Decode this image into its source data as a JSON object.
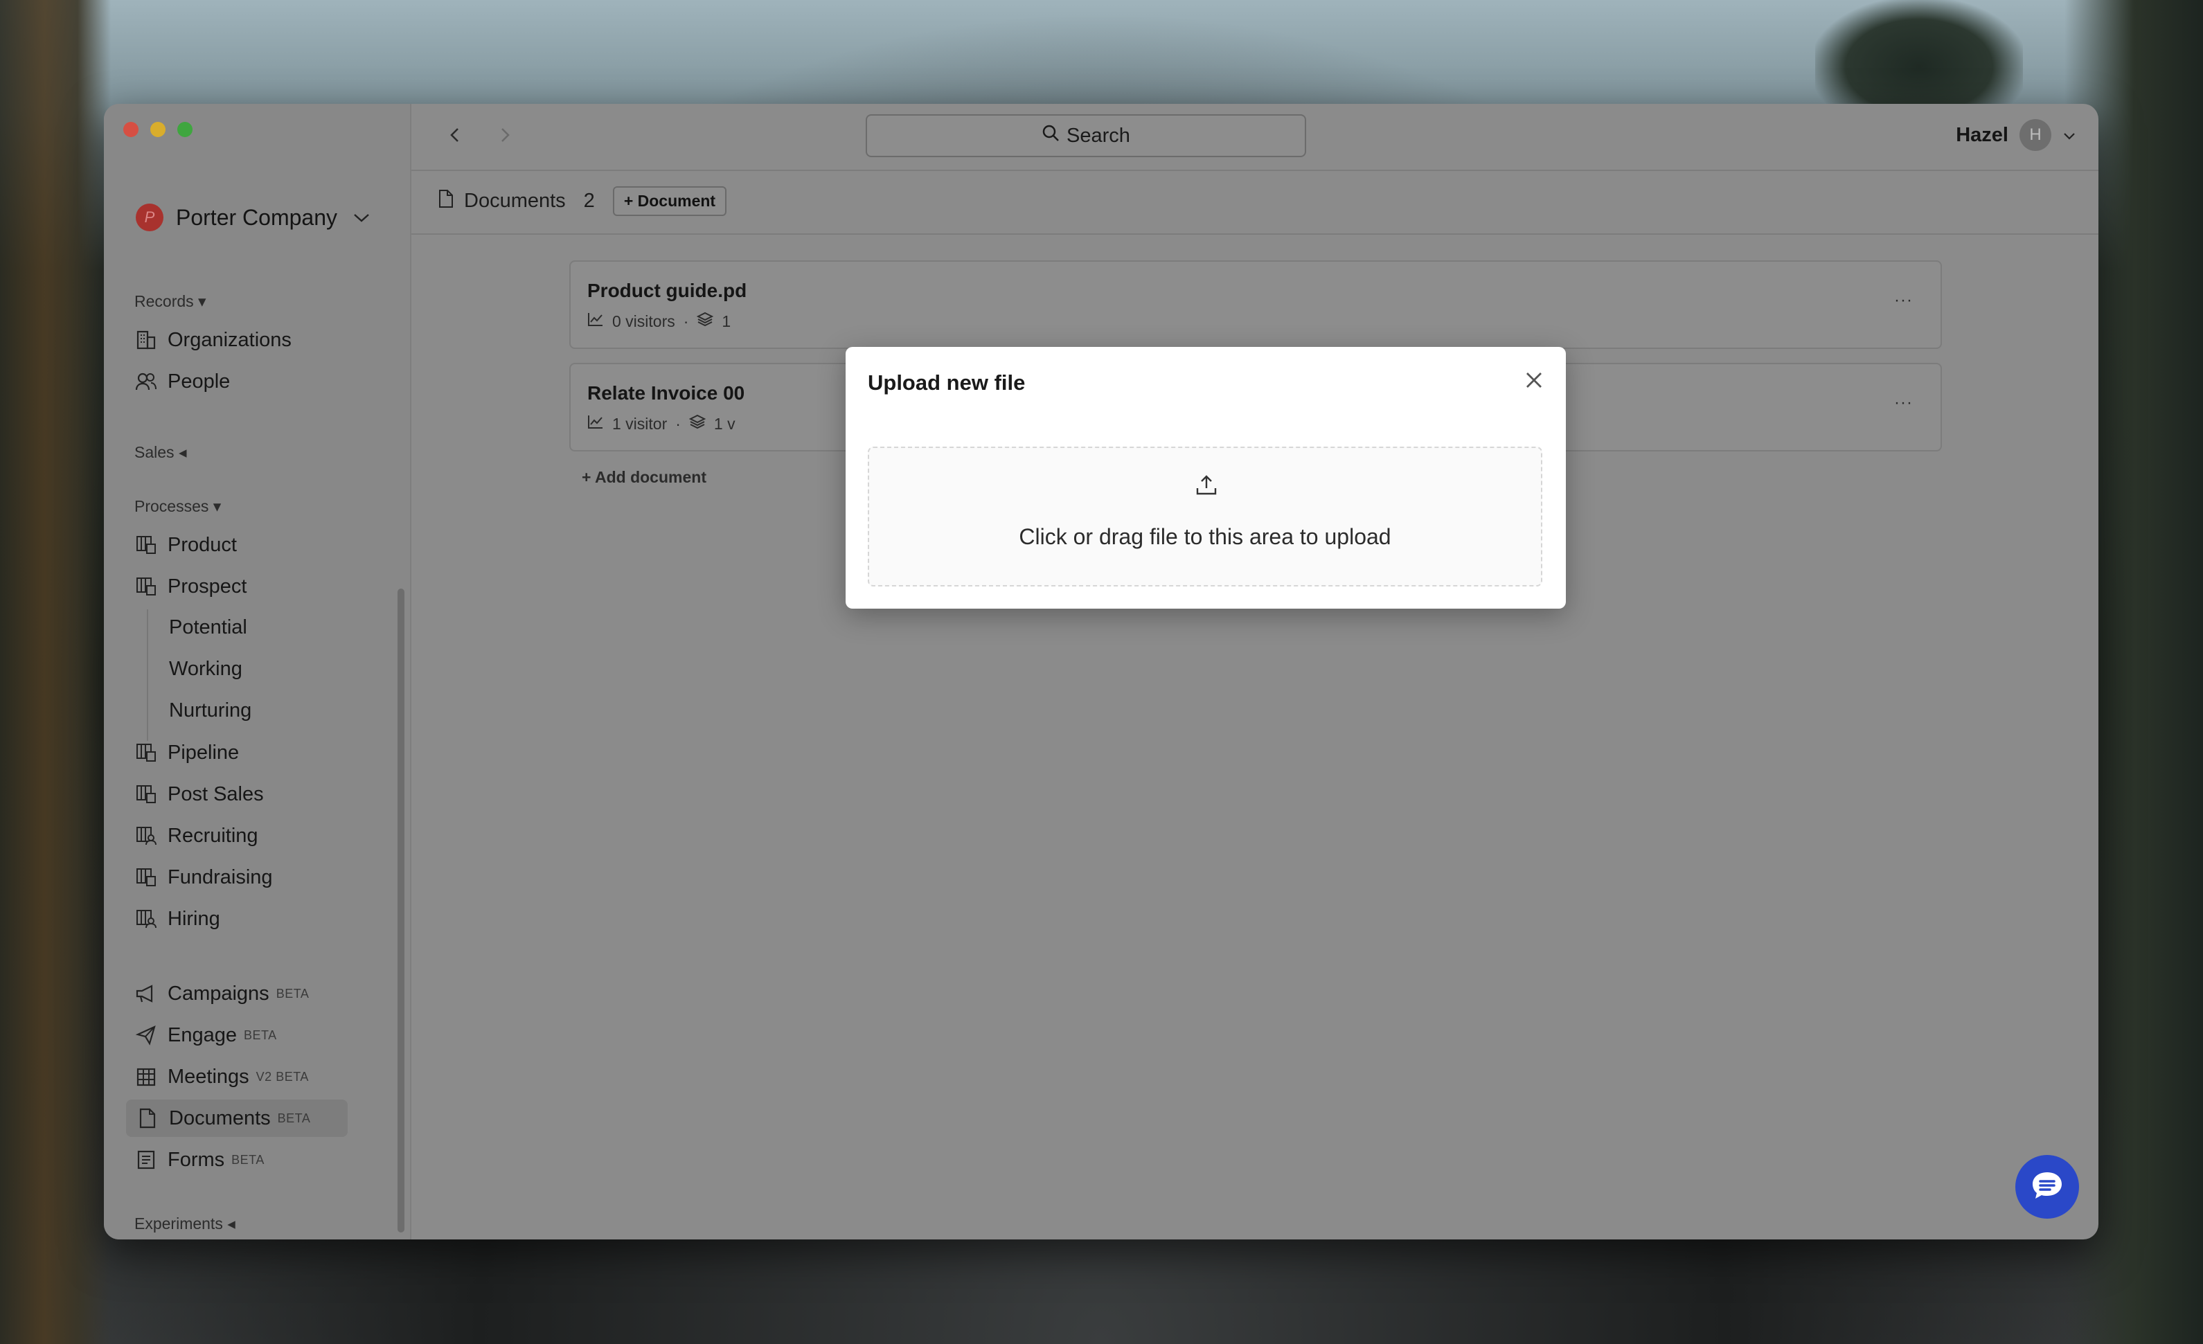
{
  "sidebar": {
    "company": {
      "logo_letter": "P",
      "name": "Porter Company"
    },
    "records": {
      "label": "Records",
      "items": [
        {
          "label": "Organizations",
          "icon": "building-icon"
        },
        {
          "label": "People",
          "icon": "people-icon"
        }
      ]
    },
    "sales": {
      "label": "Sales"
    },
    "processes": {
      "label": "Processes",
      "items": [
        {
          "label": "Product"
        },
        {
          "label": "Prospect"
        },
        {
          "label": "Potential"
        },
        {
          "label": "Working"
        },
        {
          "label": "Nurturing"
        },
        {
          "label": "Pipeline"
        },
        {
          "label": "Post Sales"
        },
        {
          "label": "Recruiting"
        },
        {
          "label": "Fundraising"
        },
        {
          "label": "Hiring"
        }
      ]
    },
    "apps": [
      {
        "label": "Campaigns",
        "badge": "BETA"
      },
      {
        "label": "Engage",
        "badge": "BETA"
      },
      {
        "label": "Meetings",
        "badge": "V2 BETA"
      },
      {
        "label": "Documents",
        "badge": "BETA"
      },
      {
        "label": "Forms",
        "badge": "BETA"
      }
    ],
    "experiments": {
      "label": "Experiments"
    }
  },
  "topbar": {
    "search_label": "Search",
    "user_name": "Hazel",
    "user_initial": "H"
  },
  "subbar": {
    "title": "Documents",
    "count": "2",
    "add_button": "Document"
  },
  "documents": [
    {
      "title": "Product guide.pd",
      "visitors": "0 visitors",
      "versions": "1"
    },
    {
      "title": "Relate Invoice 00",
      "visitors": "1 visitor",
      "versions": "1 v"
    }
  ],
  "add_document_label": "Add document",
  "modal": {
    "title": "Upload new file",
    "dropzone_text": "Click or drag file to this area to upload"
  },
  "colors": {
    "accent": "#2a48c8",
    "company_logo": "#a8322e"
  }
}
